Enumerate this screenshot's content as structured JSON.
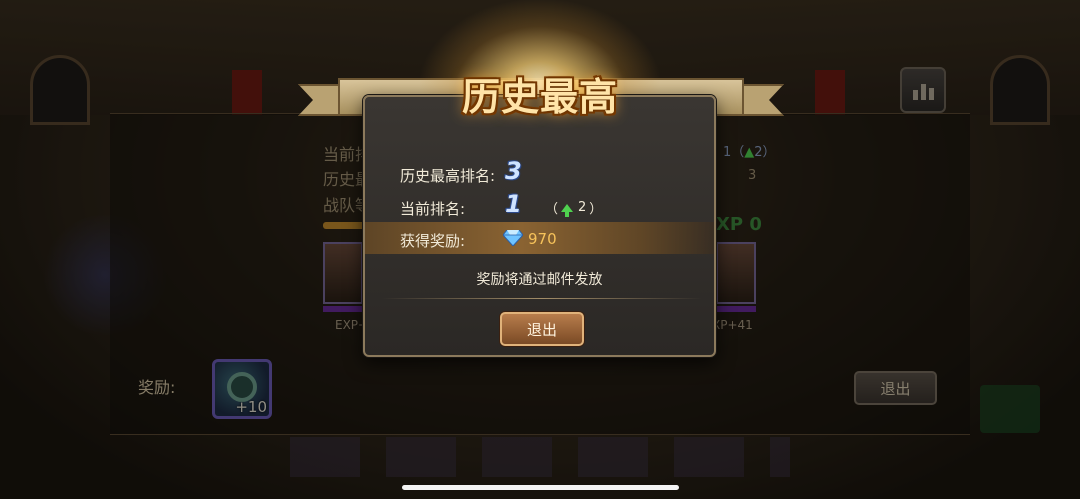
{
  "background": {
    "title": "",
    "current_rank_label": "当前排名:",
    "best_rank_label": "历史最",
    "team_label": "战队等",
    "right_rank": "1（",
    "right_rank_change": "2）",
    "right_value": "3",
    "xp_label": "XP 0",
    "exp_left": "EXP+",
    "exp_right": "XP+41",
    "reward_label": "奖励:",
    "reward_count": "+10",
    "exit_label": "退出"
  },
  "popup": {
    "title": "历史最高",
    "best_rank_label": "历史最高排名:",
    "best_rank_value": "3",
    "current_rank_label": "当前排名:",
    "current_rank_value": "1",
    "rank_change_open": "（",
    "rank_change_value": "2",
    "rank_change_close": "）",
    "reward_label": "获得奖励:",
    "reward_amount": "970",
    "mail_note": "奖励将通过邮件发放",
    "exit_label": "退出"
  },
  "icons": {
    "diamond": "diamond-icon",
    "rank_up": "arrow-up-icon",
    "stats": "bar-chart-icon"
  },
  "colors": {
    "reward_amount": "#f6c25a",
    "rank_up": "#4fd14f",
    "title_glow": "#ffae3a"
  }
}
